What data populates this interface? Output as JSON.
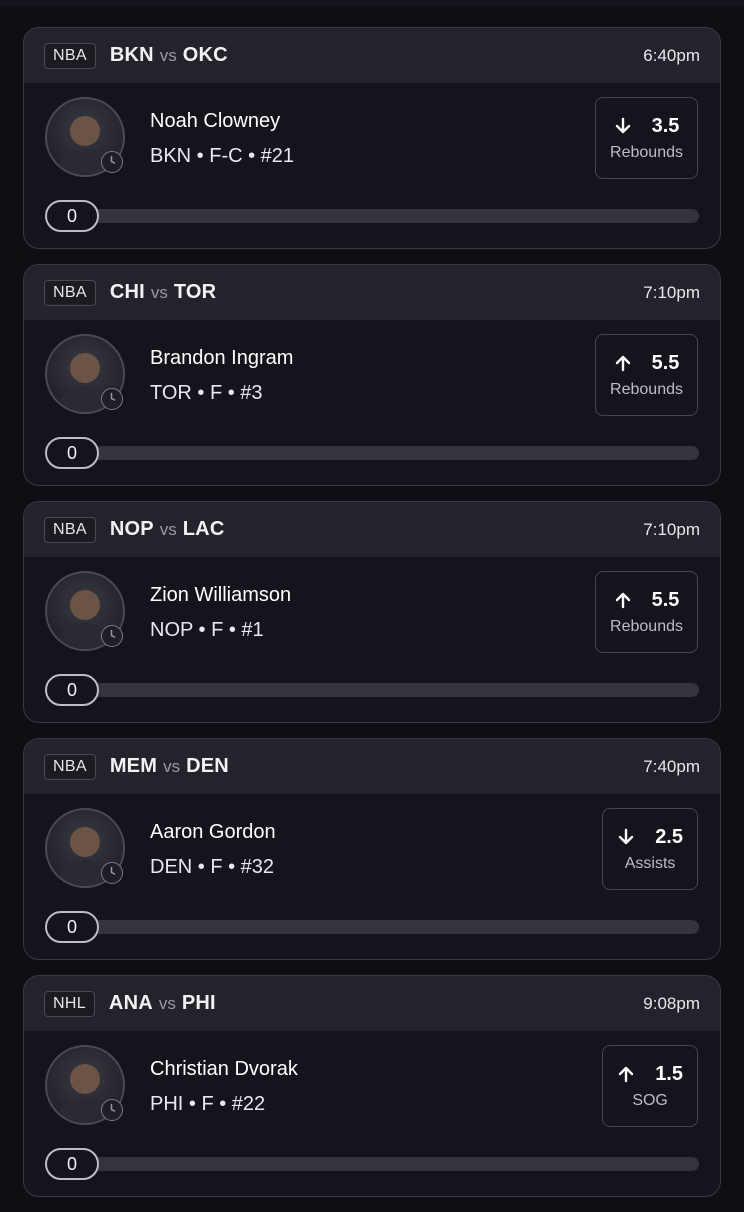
{
  "cards": [
    {
      "league": "NBA",
      "home": "BKN",
      "vs": "vs",
      "away": "OKC",
      "time": "6:40pm",
      "player": "Noah Clowney",
      "meta": "BKN • F-C • #21",
      "direction": "down",
      "line": "3.5",
      "stat": "Rebounds",
      "progress": "0",
      "progress_fraction": 0
    },
    {
      "league": "NBA",
      "home": "CHI",
      "vs": "vs",
      "away": "TOR",
      "time": "7:10pm",
      "player": "Brandon Ingram",
      "meta": "TOR • F • #3",
      "direction": "up",
      "line": "5.5",
      "stat": "Rebounds",
      "progress": "0",
      "progress_fraction": 0
    },
    {
      "league": "NBA",
      "home": "NOP",
      "vs": "vs",
      "away": "LAC",
      "time": "7:10pm",
      "player": "Zion Williamson",
      "meta": "NOP • F • #1",
      "direction": "up",
      "line": "5.5",
      "stat": "Rebounds",
      "progress": "0",
      "progress_fraction": 0
    },
    {
      "league": "NBA",
      "home": "MEM",
      "vs": "vs",
      "away": "DEN",
      "time": "7:40pm",
      "player": "Aaron Gordon",
      "meta": "DEN • F • #32",
      "direction": "down",
      "line": "2.5",
      "stat": "Assists",
      "progress": "0",
      "progress_fraction": 0
    },
    {
      "league": "NHL",
      "home": "ANA",
      "vs": "vs",
      "away": "PHI",
      "time": "9:08pm",
      "player": "Christian Dvorak",
      "meta": "PHI • F • #22",
      "direction": "up",
      "line": "1.5",
      "stat": "SOG",
      "progress": "0",
      "progress_fraction": 0
    }
  ],
  "icons": {
    "arrow_up": "arrow-up-icon",
    "arrow_down": "arrow-down-icon",
    "clock": "clock-icon",
    "avatar": "player-headshot"
  },
  "colors": {
    "background": "#0e0e14",
    "card": "#14141c",
    "card_header": "#23232b",
    "track": "#34343c"
  }
}
